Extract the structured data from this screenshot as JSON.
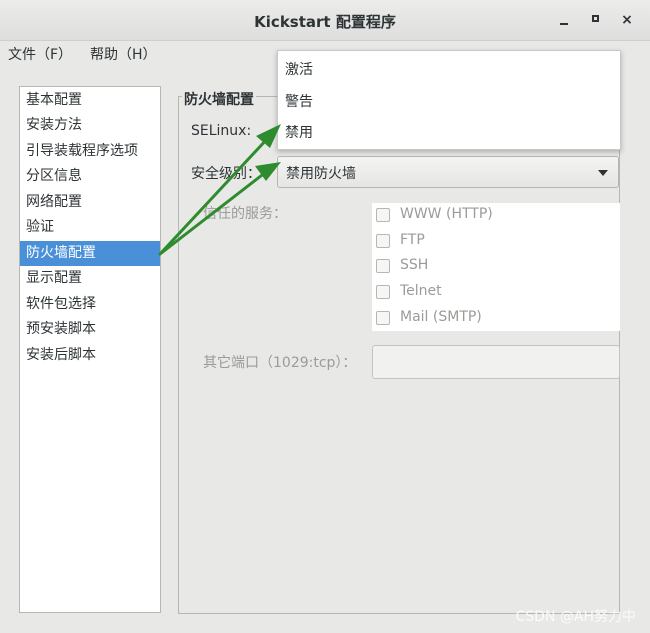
{
  "window": {
    "title": "Kickstart 配置程序",
    "minimize_icon": "minimize-icon",
    "maximize_icon": "maximize-icon",
    "close_label": "×"
  },
  "menu": {
    "file": "文件（F）",
    "help": "帮助（H）"
  },
  "sidebar": {
    "items": [
      {
        "label": "基本配置"
      },
      {
        "label": "安装方法"
      },
      {
        "label": "引导装载程序选项"
      },
      {
        "label": "分区信息"
      },
      {
        "label": "网络配置"
      },
      {
        "label": "验证"
      },
      {
        "label": "防火墙配置",
        "selected": true
      },
      {
        "label": "显示配置"
      },
      {
        "label": "软件包选择"
      },
      {
        "label": "预安装脚本"
      },
      {
        "label": "安装后脚本"
      }
    ]
  },
  "firewall": {
    "section_title": "防火墙配置",
    "selinux_label": "SELinux:",
    "security_level_label": "安全级别：",
    "security_level_value": "禁用防火墙",
    "trusted_services_label": "信任的服务：",
    "services": [
      "WWW (HTTP)",
      "FTP",
      "SSH",
      "Telnet",
      "Mail (SMTP)"
    ],
    "other_ports_label": "其它端口（1029:tcp）：",
    "other_ports_value": ""
  },
  "selinux_popup": {
    "options": [
      "激活",
      "警告",
      "禁用"
    ]
  },
  "colors": {
    "selection": "#4a90d9",
    "annotation_arrow": "#2e8b2e"
  },
  "watermark": "CSDN @AH努力中"
}
